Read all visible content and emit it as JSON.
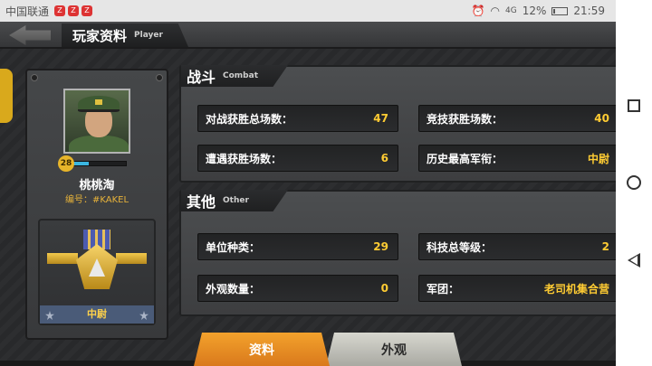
{
  "statusbar": {
    "carrier": "中国联通",
    "notifications": [
      "Z",
      "Z",
      "Z"
    ],
    "signal": "4G",
    "battery_percent_text": "12%",
    "battery_level": 0.12,
    "time": "21:59"
  },
  "header": {
    "title_cn": "玩家资料",
    "title_en": "Player"
  },
  "profile": {
    "level": "28",
    "xp_fraction": 0.3,
    "name": "桃桃淘",
    "id_text": "编号：#KAKEL",
    "rank": "中尉"
  },
  "combat": {
    "title_cn": "战斗",
    "title_en": "Combat",
    "stats": [
      {
        "label": "对战获胜总场数：",
        "value": "47"
      },
      {
        "label": "竞技获胜场数：",
        "value": "40"
      },
      {
        "label": "遭遇获胜场数：",
        "value": "6"
      },
      {
        "label": "历史最高军衔：",
        "value": "中尉"
      }
    ]
  },
  "other": {
    "title_cn": "其他",
    "title_en": "Other",
    "stats": [
      {
        "label": "单位种类：",
        "value": "29"
      },
      {
        "label": "科技总等级：",
        "value": "2"
      },
      {
        "label": "外观数量：",
        "value": "0"
      },
      {
        "label": "军团：",
        "value": "老司机集合营"
      }
    ]
  },
  "tabs": {
    "profile_label": "资料",
    "appearance_label": "外观"
  },
  "colors": {
    "accent": "#ffcc33",
    "active_tab": "#f3a22c"
  }
}
